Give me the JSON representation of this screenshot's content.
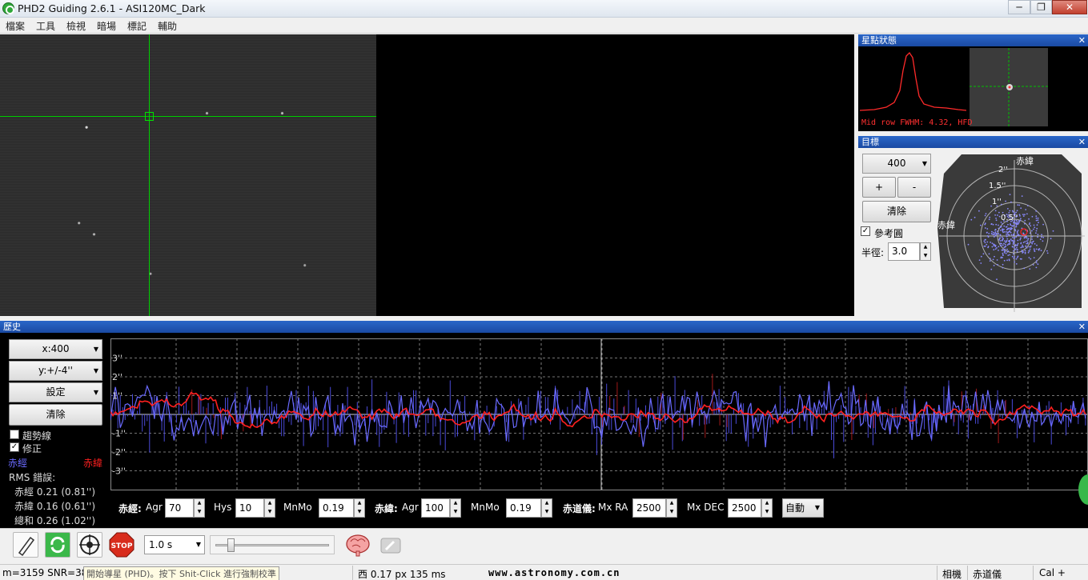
{
  "window": {
    "title": "PHD2 Guiding 2.6.1 - ASI120MC_Dark"
  },
  "menu": [
    "檔案",
    "工具",
    "檢視",
    "暗場",
    "標記",
    "輔助"
  ],
  "star_profile": {
    "title": "星點狀態",
    "readout": "Mid row FWHM: 4.32, HFD"
  },
  "target": {
    "title": "目標",
    "zoom": "400",
    "plus": "+",
    "minus": "-",
    "clear": "清除",
    "ref_circle": "參考圓",
    "radius_label": "半徑:",
    "radius": "3.0",
    "dec_label": "赤緯",
    "ra_label": "赤緯",
    "rings": [
      "2''",
      "1.5''",
      "1''",
      "0.5''"
    ]
  },
  "history": {
    "title": "歷史",
    "x_scale": "x:400",
    "y_scale": "y:+/-4''",
    "settings": "設定",
    "clear": "清除",
    "trend": "趨勢線",
    "correction": "修正",
    "ra_legend": "赤經",
    "dec_legend": "赤緯",
    "rms_title": "RMS 錯誤:",
    "rms_ra": "赤經 0.21 (0.81'')",
    "rms_dec": "赤緯 0.16 (0.61'')",
    "rms_total": "總和 0.26 (1.02'')",
    "y_ticks": [
      "3''",
      "2''",
      "1''",
      "-1''",
      "-2''",
      "-3''"
    ]
  },
  "params": {
    "ra_label": "赤經:",
    "ra_agr_label": "Agr",
    "ra_agr": "70",
    "hys_label": "Hys",
    "hys": "10",
    "ra_minmo_label": "MnMo",
    "ra_minmo": "0.19",
    "dec_label": "赤緯:",
    "dec_agr_label": "Agr",
    "dec_agr": "100",
    "dec_minmo_label": "MnMo",
    "dec_minmo": "0.19",
    "mount_label": "赤道儀:",
    "mxra_label": "Mx RA",
    "mxra": "2500",
    "mxdec_label": "Mx DEC",
    "mxdec": "2500",
    "dec_mode": "自動"
  },
  "toolbar": {
    "exposure": "1.0 s",
    "stop": "STOP"
  },
  "status": {
    "snr": "m=3159 SNR=38",
    "hint": "開始導星 (PHD)。按下 Shit-Click 進行強制校準",
    "pulse": "西  0.17 px 135 ms",
    "watermark": "www.astronomy.com.cn",
    "camera": "相機",
    "mount": "赤道儀",
    "cal": "Cal +"
  },
  "colors": {
    "ra": "#6a6aff",
    "dec": "#ff2020",
    "accent": "#1a4aa3",
    "crosshair": "#00d000"
  }
}
